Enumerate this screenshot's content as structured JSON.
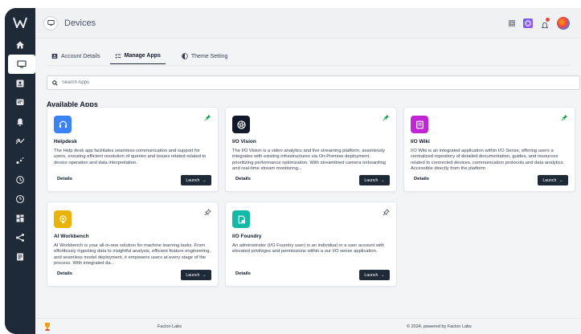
{
  "topbar": {
    "title": "Devices"
  },
  "tabs": [
    {
      "label": "Account Details"
    },
    {
      "label": "Manage Apps"
    },
    {
      "label": "Theme Setting"
    }
  ],
  "search": {
    "placeholder": "Search Apps"
  },
  "section_title": "Available Apps",
  "apps": [
    {
      "name": "Helpdesk",
      "icon": "headset-icon",
      "icon_color": "#3b82f6",
      "pinned": true,
      "description": "The Help desk app facilitates seamless communication and support for users, ensuring efficient resolution of queries and issues related  related to device operation and data interpretation.",
      "details_label": "Details",
      "launch_label": "Launch"
    },
    {
      "name": "I/O Vision",
      "icon": "camera-shutter-icon",
      "icon_color": "#111827",
      "pinned": true,
      "description": "The  I/O Vision is a video analytics and live streaming platform, seamlessly integrates with existing infrastructures via On-Premise deployment, prioritizing performance optimization. With streamlined camera onboarding and real-time stream monitoring...",
      "details_label": "Details",
      "launch_label": "Launch"
    },
    {
      "name": "I/O Wiki",
      "icon": "document-icon",
      "icon_color": "#c026d3",
      "pinned": true,
      "description": "I/O Wiki is an integrated application within I/O Sense, offering users a centralized repository of detailed documentation, guides, and resources related to connected devices, communication protocols,and data analytics. Accessible directly from the platform",
      "details_label": "Details",
      "launch_label": "Launch"
    },
    {
      "name": "AI Workbench",
      "icon": "lightbulb-icon",
      "icon_color": "#eab308",
      "pinned": false,
      "description": "AI Workbench is your all-in-one solution for machine learning tasks. From effortlessly ingesting data to insightful analysis, efficient feature engineering, and seamless model deployment, it empowers users at every stage of the process. With integrated da...",
      "details_label": "Details",
      "launch_label": "Launch"
    },
    {
      "name": "I/O Foundry",
      "icon": "foundry-icon",
      "icon_color": "#14b8a6",
      "pinned": false,
      "description": "An administrator (I/O Foundry user) is an individual or a user account with elevated privileges and permissions within a our I/O sense application.",
      "details_label": "Details",
      "launch_label": "Launch"
    }
  ],
  "footer": {
    "left": "Faclon Labs",
    "right": "© 2024, powered by Faclon Labs"
  },
  "colors": {
    "sidebar": "#1e2a38",
    "accent": "#1e2a38",
    "pin_active": "#16a34a"
  }
}
